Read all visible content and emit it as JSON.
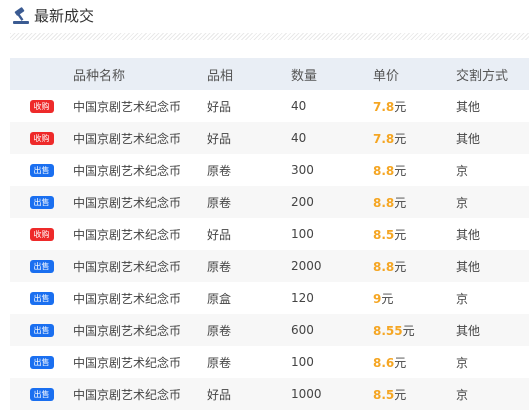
{
  "header": {
    "title": "最新成交",
    "icon": "gavel-icon"
  },
  "colors": {
    "buy_badge": "#ee2a2a",
    "sell_badge": "#1a6ff0",
    "price": "#f5a623",
    "header_bg": "#e9eef5"
  },
  "table": {
    "columns": [
      "",
      "品种名称",
      "品相",
      "数量",
      "单价",
      "交割方式"
    ],
    "rows": [
      {
        "type": "收购",
        "kind": "buy",
        "name": "中国京剧艺术纪念币",
        "quality": "好品",
        "qty": "40",
        "price": "7.8",
        "unit": "元",
        "method": "其他"
      },
      {
        "type": "收购",
        "kind": "buy",
        "name": "中国京剧艺术纪念币",
        "quality": "好品",
        "qty": "40",
        "price": "7.8",
        "unit": "元",
        "method": "其他"
      },
      {
        "type": "出售",
        "kind": "sell",
        "name": "中国京剧艺术纪念币",
        "quality": "原卷",
        "qty": "300",
        "price": "8.8",
        "unit": "元",
        "method": "京"
      },
      {
        "type": "出售",
        "kind": "sell",
        "name": "中国京剧艺术纪念币",
        "quality": "原卷",
        "qty": "200",
        "price": "8.8",
        "unit": "元",
        "method": "京"
      },
      {
        "type": "收购",
        "kind": "buy",
        "name": "中国京剧艺术纪念币",
        "quality": "好品",
        "qty": "100",
        "price": "8.5",
        "unit": "元",
        "method": "其他"
      },
      {
        "type": "出售",
        "kind": "sell",
        "name": "中国京剧艺术纪念币",
        "quality": "原卷",
        "qty": "2000",
        "price": "8.8",
        "unit": "元",
        "method": "其他"
      },
      {
        "type": "出售",
        "kind": "sell",
        "name": "中国京剧艺术纪念币",
        "quality": "原盒",
        "qty": "120",
        "price": "9",
        "unit": "元",
        "method": "京"
      },
      {
        "type": "出售",
        "kind": "sell",
        "name": "中国京剧艺术纪念币",
        "quality": "原卷",
        "qty": "600",
        "price": "8.55",
        "unit": "元",
        "method": "其他"
      },
      {
        "type": "出售",
        "kind": "sell",
        "name": "中国京剧艺术纪念币",
        "quality": "原卷",
        "qty": "100",
        "price": "8.6",
        "unit": "元",
        "method": "京"
      },
      {
        "type": "出售",
        "kind": "sell",
        "name": "中国京剧艺术纪念币",
        "quality": "好品",
        "qty": "1000",
        "price": "8.5",
        "unit": "元",
        "method": "京"
      }
    ]
  }
}
